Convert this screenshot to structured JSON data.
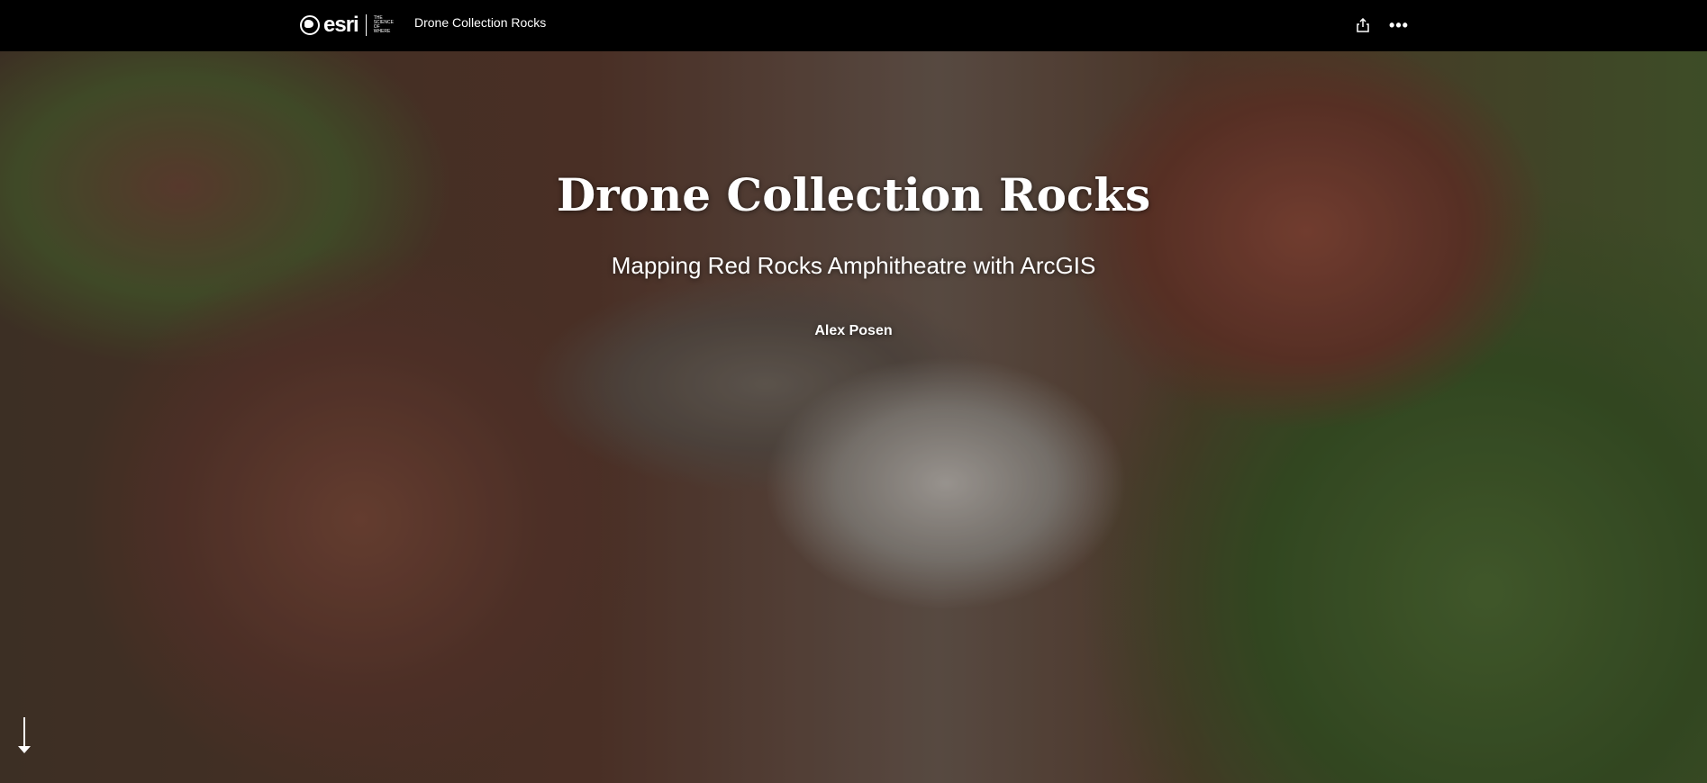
{
  "header": {
    "logo_text": "esri",
    "logo_tagline": "THE SCIENCE OF WHERE",
    "title": "Drone Collection Rocks",
    "share_icon": "share-icon",
    "more_icon": "more-options-icon",
    "more_glyph": "•••"
  },
  "cover": {
    "title": "Drone Collection Rocks",
    "subtitle": "Mapping Red Rocks Amphitheatre with ArcGIS",
    "author": "Alex Posen"
  },
  "scroll_icon": "arrow-down-icon"
}
